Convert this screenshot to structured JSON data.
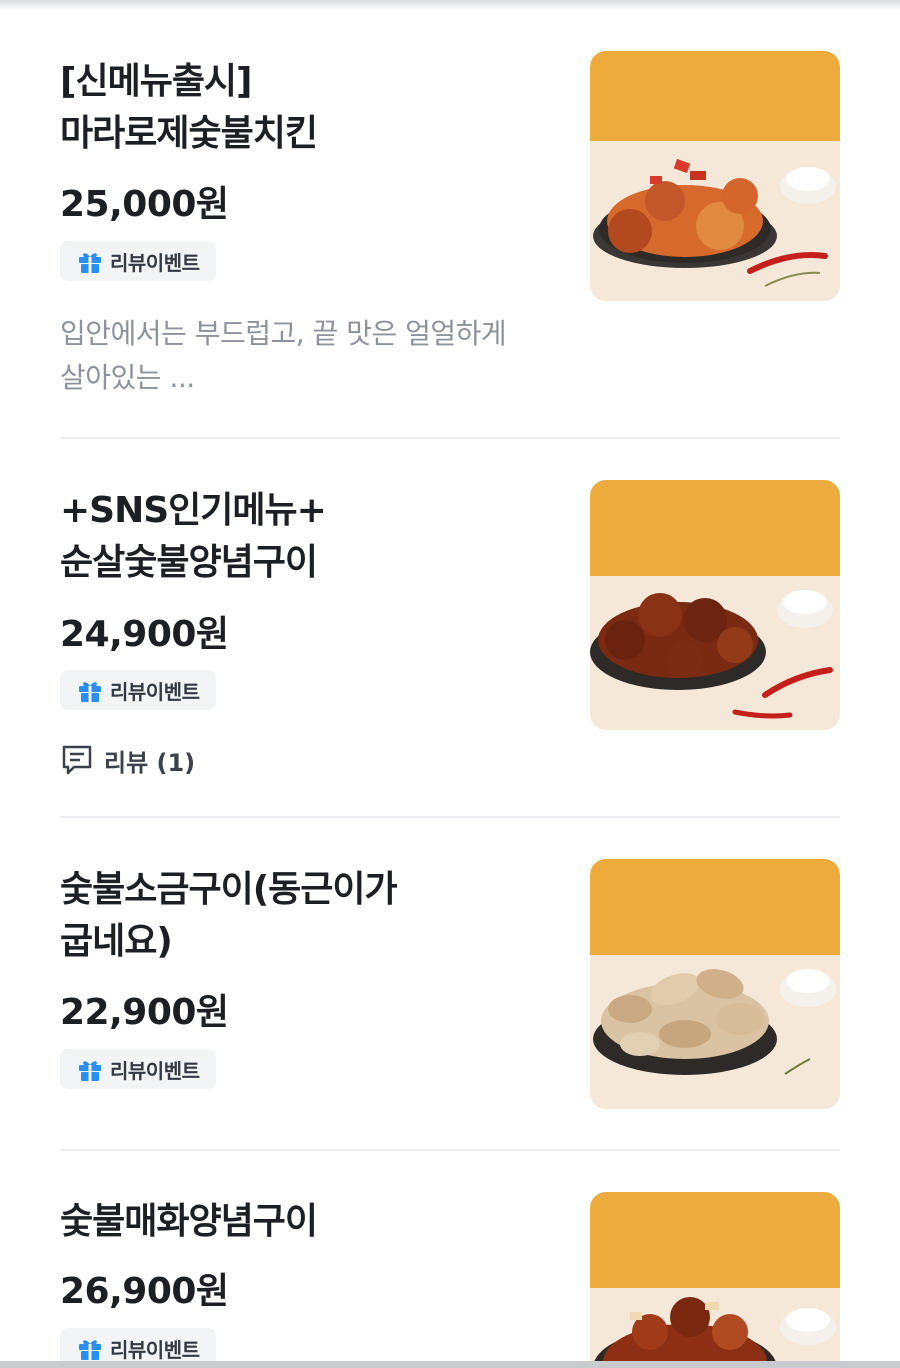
{
  "menu": {
    "items": [
      {
        "name": "[신메뉴출시]\n마라로제숯불치킨",
        "price": "25,000원",
        "badge": "리뷰이벤트",
        "description": "입안에서는 부드럽고, 끝 맛은 얼얼하게\n살아있는 ...",
        "image": "spicy-rose-chicken-photo"
      },
      {
        "name": "+SNS인기메뉴+\n순살숯불양념구이",
        "price": "24,900원",
        "badge": "리뷰이벤트",
        "review": "리뷰 (1)",
        "image": "boneless-seasoned-chicken-photo"
      },
      {
        "name": "숯불소금구이(동근이가\n굽네요)",
        "price": "22,900원",
        "badge": "리뷰이벤트",
        "image": "salt-grilled-chicken-photo"
      },
      {
        "name": "숯불매화양념구이",
        "price": "26,900원",
        "badge": "리뷰이벤트",
        "image": "plum-seasoned-chicken-photo"
      }
    ]
  },
  "colors": {
    "text_primary": "#1c1f24",
    "text_secondary": "#8d939c",
    "badge_bg": "#f3f4f6",
    "gift_icon": "#2a8ef5",
    "thumb_bg_top": "#eeab3d",
    "thumb_bg_bottom": "#f6e8d8"
  }
}
